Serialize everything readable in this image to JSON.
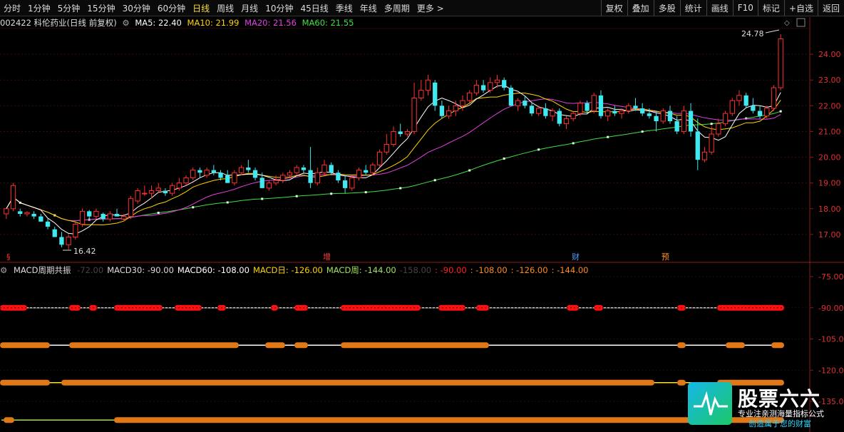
{
  "toolbar": {
    "periods": [
      "分时",
      "1分钟",
      "5分钟",
      "15分钟",
      "30分钟",
      "60分钟",
      "日线",
      "周线",
      "月线",
      "10分钟",
      "45日线",
      "季线",
      "年线",
      "多周期",
      "更多 >"
    ],
    "active": "日线",
    "right": [
      "复权",
      "叠加",
      "多股",
      "统计",
      "画线",
      "F10",
      "标记",
      "+自选",
      "返回"
    ]
  },
  "stock": {
    "title": "002422 科伦药业(日线 前复权)",
    "ma5": "MA5: 22.40",
    "ma10": "MA10: 21.99",
    "ma20": "MA20: 21.56",
    "ma60": "MA60: 21.55",
    "max_label": "24.78",
    "min_label": "16.42",
    "price_axis": [
      "24.00",
      "23.00",
      "22.00",
      "21.00",
      "20.00",
      "19.00",
      "18.00",
      "17.00"
    ],
    "markers": [
      "增",
      "财",
      "预"
    ]
  },
  "indicator": {
    "name": "MACD周期共振",
    "labels": [
      {
        "t": "-72.00",
        "c": "#444"
      },
      {
        "t": "MACD30: -90.00",
        "c": "#dddddd"
      },
      {
        "t": "MACD60: -108.00",
        "c": "#ffffff"
      },
      {
        "t": "MACD日: -126.00",
        "c": "#ffd400"
      },
      {
        "t": "MACD周: -144.00",
        "c": "#a0e060"
      },
      {
        "t": "-158.00",
        "c": "#444"
      },
      {
        "t": ": -90.00",
        "c": "#ff2020"
      },
      {
        "t": ": -108.00",
        "c": "#ff8c1a"
      },
      {
        "t": ": -126.00",
        "c": "#ff8c1a"
      },
      {
        "t": ": -144.00",
        "c": "#ff8c1a"
      }
    ],
    "axis": [
      "-75.00",
      "-90.00",
      "-105.00",
      "-120.00",
      "-135.00"
    ]
  },
  "chart_data": {
    "type": "candlestick",
    "ylim": [
      16,
      25
    ],
    "ohlc": [
      [
        17.8,
        18.0,
        17.6,
        18.0
      ],
      [
        18.0,
        19.0,
        17.9,
        18.9
      ],
      [
        17.9,
        18.0,
        17.7,
        17.8
      ],
      [
        17.8,
        17.9,
        17.7,
        17.85
      ],
      [
        17.8,
        17.9,
        17.6,
        17.7
      ],
      [
        17.7,
        17.8,
        17.5,
        17.5
      ],
      [
        17.5,
        17.6,
        17.2,
        17.3
      ],
      [
        17.2,
        17.3,
        16.9,
        16.9
      ],
      [
        16.9,
        17.1,
        16.5,
        16.6
      ],
      [
        16.6,
        17.0,
        16.42,
        16.9
      ],
      [
        16.9,
        17.5,
        16.8,
        17.4
      ],
      [
        17.4,
        18.0,
        17.3,
        17.9
      ],
      [
        17.9,
        17.95,
        17.6,
        17.7
      ],
      [
        17.7,
        18.0,
        17.6,
        17.9
      ],
      [
        17.8,
        17.85,
        17.5,
        17.6
      ],
      [
        17.6,
        17.9,
        17.5,
        17.8
      ],
      [
        17.8,
        18.0,
        17.7,
        17.7
      ],
      [
        17.6,
        17.8,
        17.5,
        17.7
      ],
      [
        17.7,
        18.5,
        17.6,
        18.4
      ],
      [
        18.3,
        18.8,
        18.2,
        18.7
      ],
      [
        18.6,
        18.9,
        18.5,
        18.6
      ],
      [
        18.6,
        18.9,
        18.4,
        18.7
      ],
      [
        18.7,
        19.0,
        18.6,
        18.8
      ],
      [
        18.7,
        18.8,
        18.5,
        18.6
      ],
      [
        18.6,
        19.0,
        18.5,
        18.9
      ],
      [
        18.8,
        19.2,
        18.7,
        19.0
      ],
      [
        19.0,
        19.3,
        18.9,
        19.2
      ],
      [
        19.2,
        19.6,
        19.1,
        19.5
      ],
      [
        19.5,
        19.6,
        19.2,
        19.4
      ],
      [
        19.3,
        19.6,
        19.2,
        19.5
      ],
      [
        19.5,
        19.7,
        19.3,
        19.4
      ],
      [
        19.4,
        19.5,
        19.1,
        19.2
      ],
      [
        19.3,
        19.5,
        19.0,
        19.0
      ],
      [
        19.0,
        19.5,
        18.9,
        19.4
      ],
      [
        19.4,
        19.7,
        19.3,
        19.6
      ],
      [
        19.6,
        19.9,
        19.4,
        19.5
      ],
      [
        19.5,
        19.6,
        19.1,
        19.2
      ],
      [
        19.2,
        19.4,
        18.8,
        18.8
      ],
      [
        18.8,
        19.1,
        18.7,
        19.0
      ],
      [
        19.0,
        19.3,
        18.9,
        19.1
      ],
      [
        19.1,
        19.4,
        19.0,
        19.3
      ],
      [
        19.3,
        19.5,
        19.2,
        19.4
      ],
      [
        19.4,
        19.7,
        19.3,
        19.6
      ],
      [
        19.6,
        19.7,
        19.4,
        19.5
      ],
      [
        19.5,
        20.4,
        18.8,
        19.0
      ],
      [
        19.0,
        19.6,
        18.9,
        19.4
      ],
      [
        19.4,
        19.9,
        19.3,
        19.7
      ],
      [
        19.7,
        19.8,
        19.3,
        19.4
      ],
      [
        19.4,
        19.5,
        19.0,
        19.1
      ],
      [
        19.1,
        19.3,
        18.6,
        18.8
      ],
      [
        18.8,
        19.3,
        18.7,
        19.2
      ],
      [
        19.2,
        19.6,
        19.1,
        19.5
      ],
      [
        19.5,
        19.7,
        19.3,
        19.4
      ],
      [
        19.4,
        19.8,
        19.3,
        19.7
      ],
      [
        19.7,
        20.3,
        19.6,
        20.2
      ],
      [
        20.2,
        20.9,
        20.1,
        20.5
      ],
      [
        20.5,
        21.2,
        20.4,
        21.0
      ],
      [
        21.0,
        21.3,
        20.8,
        20.9
      ],
      [
        20.9,
        21.1,
        20.8,
        21.0
      ],
      [
        21.0,
        22.9,
        20.9,
        22.3
      ],
      [
        22.3,
        23.0,
        22.2,
        22.6
      ],
      [
        22.6,
        23.2,
        22.4,
        23.0
      ],
      [
        22.9,
        23.0,
        21.8,
        22.0
      ],
      [
        22.0,
        22.2,
        21.5,
        21.6
      ],
      [
        21.6,
        22.0,
        21.5,
        21.8
      ],
      [
        21.8,
        22.2,
        21.6,
        22.0
      ],
      [
        22.0,
        22.4,
        21.8,
        22.2
      ],
      [
        22.2,
        22.6,
        22.1,
        22.5
      ],
      [
        22.5,
        23.0,
        22.4,
        22.8
      ],
      [
        22.8,
        23.0,
        22.5,
        22.6
      ],
      [
        22.6,
        23.1,
        22.5,
        22.9
      ],
      [
        22.9,
        23.2,
        22.7,
        23.0
      ],
      [
        23.0,
        23.1,
        22.6,
        22.7
      ],
      [
        22.7,
        22.8,
        22.0,
        22.0
      ],
      [
        22.0,
        22.3,
        21.8,
        22.2
      ],
      [
        22.2,
        22.4,
        21.9,
        22.0
      ],
      [
        22.0,
        22.1,
        21.6,
        21.7
      ],
      [
        21.7,
        22.0,
        21.6,
        21.9
      ],
      [
        21.9,
        22.1,
        21.5,
        21.6
      ],
      [
        21.6,
        21.9,
        21.4,
        21.8
      ],
      [
        21.8,
        21.9,
        21.2,
        21.3
      ],
      [
        21.3,
        21.6,
        21.1,
        21.5
      ],
      [
        21.5,
        21.8,
        21.4,
        21.7
      ],
      [
        21.7,
        22.2,
        21.6,
        22.1
      ],
      [
        22.1,
        22.2,
        21.7,
        21.8
      ],
      [
        21.8,
        22.5,
        21.7,
        22.4
      ],
      [
        22.4,
        22.6,
        21.5,
        21.6
      ],
      [
        21.6,
        21.9,
        21.4,
        21.8
      ],
      [
        21.8,
        22.0,
        21.6,
        21.7
      ],
      [
        21.7,
        21.9,
        21.5,
        21.8
      ],
      [
        21.8,
        22.1,
        21.7,
        22.0
      ],
      [
        22.0,
        22.3,
        21.8,
        21.9
      ],
      [
        21.9,
        22.1,
        21.6,
        21.7
      ],
      [
        21.7,
        21.9,
        21.5,
        21.6
      ],
      [
        21.6,
        21.8,
        21.0,
        21.4
      ],
      [
        21.4,
        21.9,
        21.3,
        21.8
      ],
      [
        21.8,
        22.0,
        21.3,
        21.4
      ],
      [
        21.4,
        21.6,
        20.9,
        21.0
      ],
      [
        21.0,
        22.0,
        20.9,
        21.8
      ],
      [
        21.8,
        22.1,
        20.8,
        21.0
      ],
      [
        21.0,
        21.5,
        19.5,
        19.9
      ],
      [
        19.9,
        20.4,
        19.8,
        20.2
      ],
      [
        20.2,
        21.2,
        20.1,
        20.9
      ],
      [
        20.9,
        21.5,
        20.8,
        21.3
      ],
      [
        21.3,
        21.8,
        21.2,
        21.7
      ],
      [
        21.7,
        22.3,
        21.6,
        22.2
      ],
      [
        22.2,
        22.6,
        22.0,
        22.4
      ],
      [
        22.4,
        22.5,
        21.9,
        22.0
      ],
      [
        22.0,
        22.3,
        21.7,
        21.8
      ],
      [
        21.8,
        22.0,
        21.5,
        21.6
      ],
      [
        21.6,
        22.0,
        21.5,
        21.9
      ],
      [
        21.9,
        22.8,
        21.8,
        22.7
      ],
      [
        22.7,
        24.78,
        22.6,
        24.6
      ]
    ],
    "resonance_bars": [
      {
        "name": "MACD30",
        "level": -90,
        "on": [
          [
            0,
            38
          ],
          [
            97,
            113
          ],
          [
            125,
            136
          ],
          [
            160,
            228
          ],
          [
            245,
            283
          ],
          [
            305,
            317
          ],
          [
            380,
            390
          ],
          [
            413,
            432
          ],
          [
            478,
            590
          ],
          [
            615,
            653
          ],
          [
            668,
            686
          ],
          [
            795,
            812
          ],
          [
            833,
            846
          ],
          [
            950,
            962
          ],
          [
            1006,
            1100
          ]
        ]
      },
      {
        "name": "MACD60",
        "level": -108,
        "on": [
          [
            0,
            70
          ],
          [
            97,
            335
          ],
          [
            372,
            400
          ],
          [
            413,
            432
          ],
          [
            478,
            686
          ],
          [
            950,
            962
          ],
          [
            1018,
            1045
          ],
          [
            1082,
            1100
          ]
        ]
      },
      {
        "name": "MACD日",
        "level": -126,
        "on": [
          [
            0,
            70
          ],
          [
            86,
            918
          ],
          [
            950,
            962
          ],
          [
            1006,
            1100
          ]
        ]
      },
      {
        "name": "MACD周",
        "level": -144,
        "on": [
          [
            5,
            20
          ],
          [
            160,
            1100
          ]
        ]
      }
    ]
  },
  "logo": {
    "title": "股票六六",
    "sub1": "专业注亲测海量指标公式",
    "sub2": "创造属于您的财富"
  }
}
